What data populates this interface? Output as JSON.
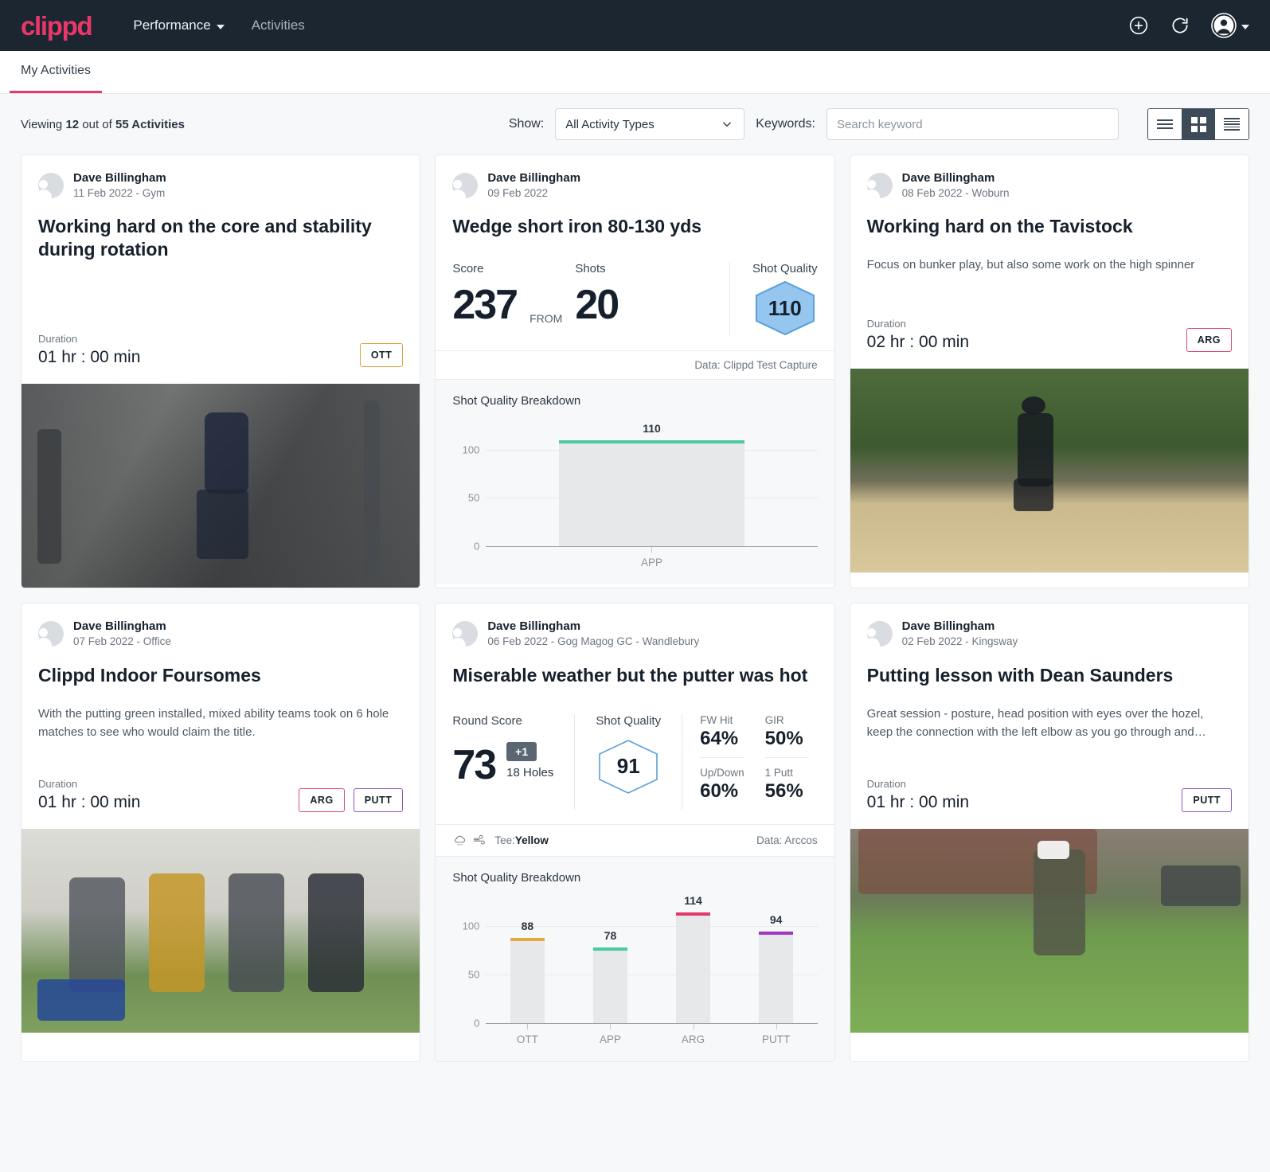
{
  "navbar": {
    "brand": "clippd",
    "links": [
      {
        "label": "Performance",
        "icon": "chevron-down-icon"
      },
      {
        "label": "Activities"
      }
    ],
    "actions": {
      "add": "add-circle-icon",
      "refresh": "refresh-icon",
      "account": "account-avatar-icon"
    }
  },
  "tabs": [
    {
      "label": "My Activities",
      "active": true
    }
  ],
  "toolbar": {
    "viewing_prefix": "Viewing ",
    "viewing_count": "12",
    "viewing_middle": " out of ",
    "viewing_total": "55 Activities",
    "show_label": "Show:",
    "activity_type_selected": "All Activity Types",
    "keywords_label": "Keywords:",
    "search_placeholder": "Search keyword",
    "search_value": "",
    "view_modes": [
      "list-view",
      "grid-view",
      "compact-view"
    ],
    "view_mode_selected": "grid-view"
  },
  "colors": {
    "brand": "#e8386a",
    "navbar": "#1b2631",
    "ott": "#d8a63c",
    "app": "#4bc9a0",
    "arg": "#e04a6e",
    "putt": "#8b57c5",
    "hex_fill": "#94c6f0",
    "hex_stroke": "#5a9fd8"
  },
  "cards": [
    {
      "author": "Dave Billingham",
      "meta": "11 Feb 2022 - Gym",
      "title": "Working hard on the core and stability during rotation",
      "description": "",
      "duration_label": "Duration",
      "duration_value": "01 hr : 00 min",
      "tags": [
        "OTT"
      ],
      "photo": "gym"
    },
    {
      "author": "Dave Billingham",
      "meta": "09 Feb 2022",
      "title": "Wedge short iron 80-130 yds",
      "stats": {
        "score_label": "Score",
        "score_value": "237",
        "from_label": "FROM",
        "shots_label": "Shots",
        "shots_value": "20",
        "shot_quality_label": "Shot Quality",
        "shot_quality_value": "110"
      },
      "data_source": "Data: Clippd Test Capture",
      "chart_data": {
        "type": "bar",
        "title": "Shot Quality Breakdown",
        "categories": [
          "APP"
        ],
        "values": [
          110
        ],
        "bar_colors": [
          "#4bc9a0"
        ],
        "ylim": [
          0,
          130
        ],
        "yticks": [
          0,
          50,
          100
        ],
        "xlabel": "",
        "ylabel": "",
        "grid": true,
        "legend": "none"
      }
    },
    {
      "author": "Dave Billingham",
      "meta": "08 Feb 2022 - Woburn",
      "title": "Working hard on the Tavistock",
      "description": "Focus on bunker play, but also some work on the high spinner",
      "duration_label": "Duration",
      "duration_value": "02 hr : 00 min",
      "tags": [
        "ARG"
      ],
      "photo": "bunker"
    },
    {
      "author": "Dave Billingham",
      "meta": "07 Feb 2022 - Office",
      "title": "Clippd Indoor Foursomes",
      "description": "With the putting green installed, mixed ability teams took on 6 hole matches to see who would claim the title.",
      "duration_label": "Duration",
      "duration_value": "01 hr : 00 min",
      "tags": [
        "ARG",
        "PUTT"
      ],
      "photo": "indoor"
    },
    {
      "author": "Dave Billingham",
      "meta": "06 Feb 2022 - Gog Magog GC - Wandlebury",
      "title": "Miserable weather but the putter was hot",
      "stats": {
        "round_score_label": "Round Score",
        "round_score_value": "73",
        "over_par": "+1",
        "holes": "18 Holes",
        "shot_quality_label": "Shot Quality",
        "shot_quality_value": "91",
        "kpis": [
          {
            "label": "FW Hit",
            "value": "64%"
          },
          {
            "label": "GIR",
            "value": "50%"
          },
          {
            "label": "Up/Down",
            "value": "60%"
          },
          {
            "label": "1 Putt",
            "value": "56%"
          }
        ]
      },
      "conditions": {
        "weather_icons": [
          "rain-cloud-icon",
          "wind-icon"
        ],
        "tee_label": "Tee: ",
        "tee_value": "Yellow"
      },
      "data_source": "Data: Arccos",
      "chart_data": {
        "type": "bar",
        "title": "Shot Quality Breakdown",
        "categories": [
          "OTT",
          "APP",
          "ARG",
          "PUTT"
        ],
        "values": [
          88,
          78,
          114,
          94
        ],
        "bar_colors": [
          "#e5ab3c",
          "#4bc9a0",
          "#e0396a",
          "#9b38c4"
        ],
        "ylim": [
          0,
          130
        ],
        "yticks": [
          0,
          50,
          100
        ],
        "xlabel": "",
        "ylabel": "",
        "grid": true,
        "legend": "none"
      }
    },
    {
      "author": "Dave Billingham",
      "meta": "02 Feb 2022 - Kingsway",
      "title": "Putting lesson with Dean Saunders",
      "description": "Great session - posture, head position with eyes over the hozel, keep the connection with the left elbow as you go through and…",
      "duration_label": "Duration",
      "duration_value": "01 hr : 00 min",
      "tags": [
        "PUTT"
      ],
      "photo": "putting"
    }
  ]
}
